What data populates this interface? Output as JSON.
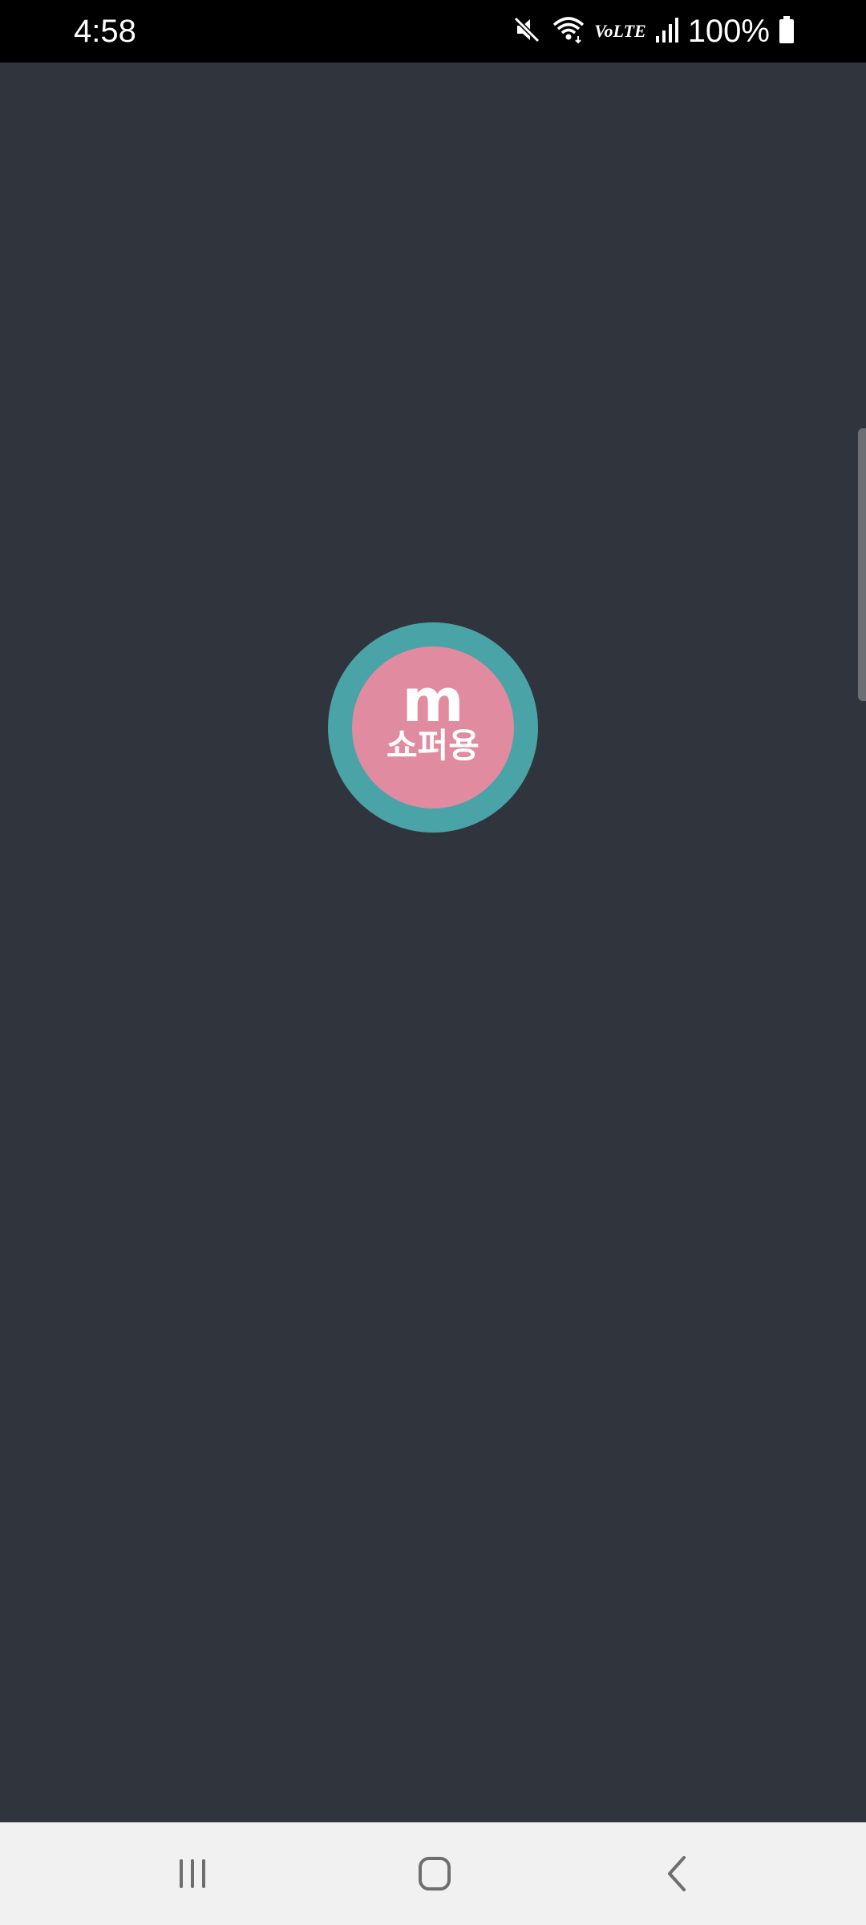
{
  "status_bar": {
    "time": "4:58",
    "battery_percent": "100%",
    "network_label": "VoLTE",
    "icons": [
      "mute-icon",
      "wifi-icon",
      "volte-icon",
      "signal-icon",
      "battery-icon"
    ]
  },
  "logo": {
    "letter": "m",
    "text": "쇼퍼용",
    "colors": {
      "ring": "#4aa3a6",
      "fill": "#e08ba0",
      "text": "#ffffff"
    }
  },
  "screen": {
    "background": "#30353d"
  },
  "nav_bar": {
    "icons": [
      "recents-icon",
      "home-icon",
      "back-icon"
    ]
  }
}
